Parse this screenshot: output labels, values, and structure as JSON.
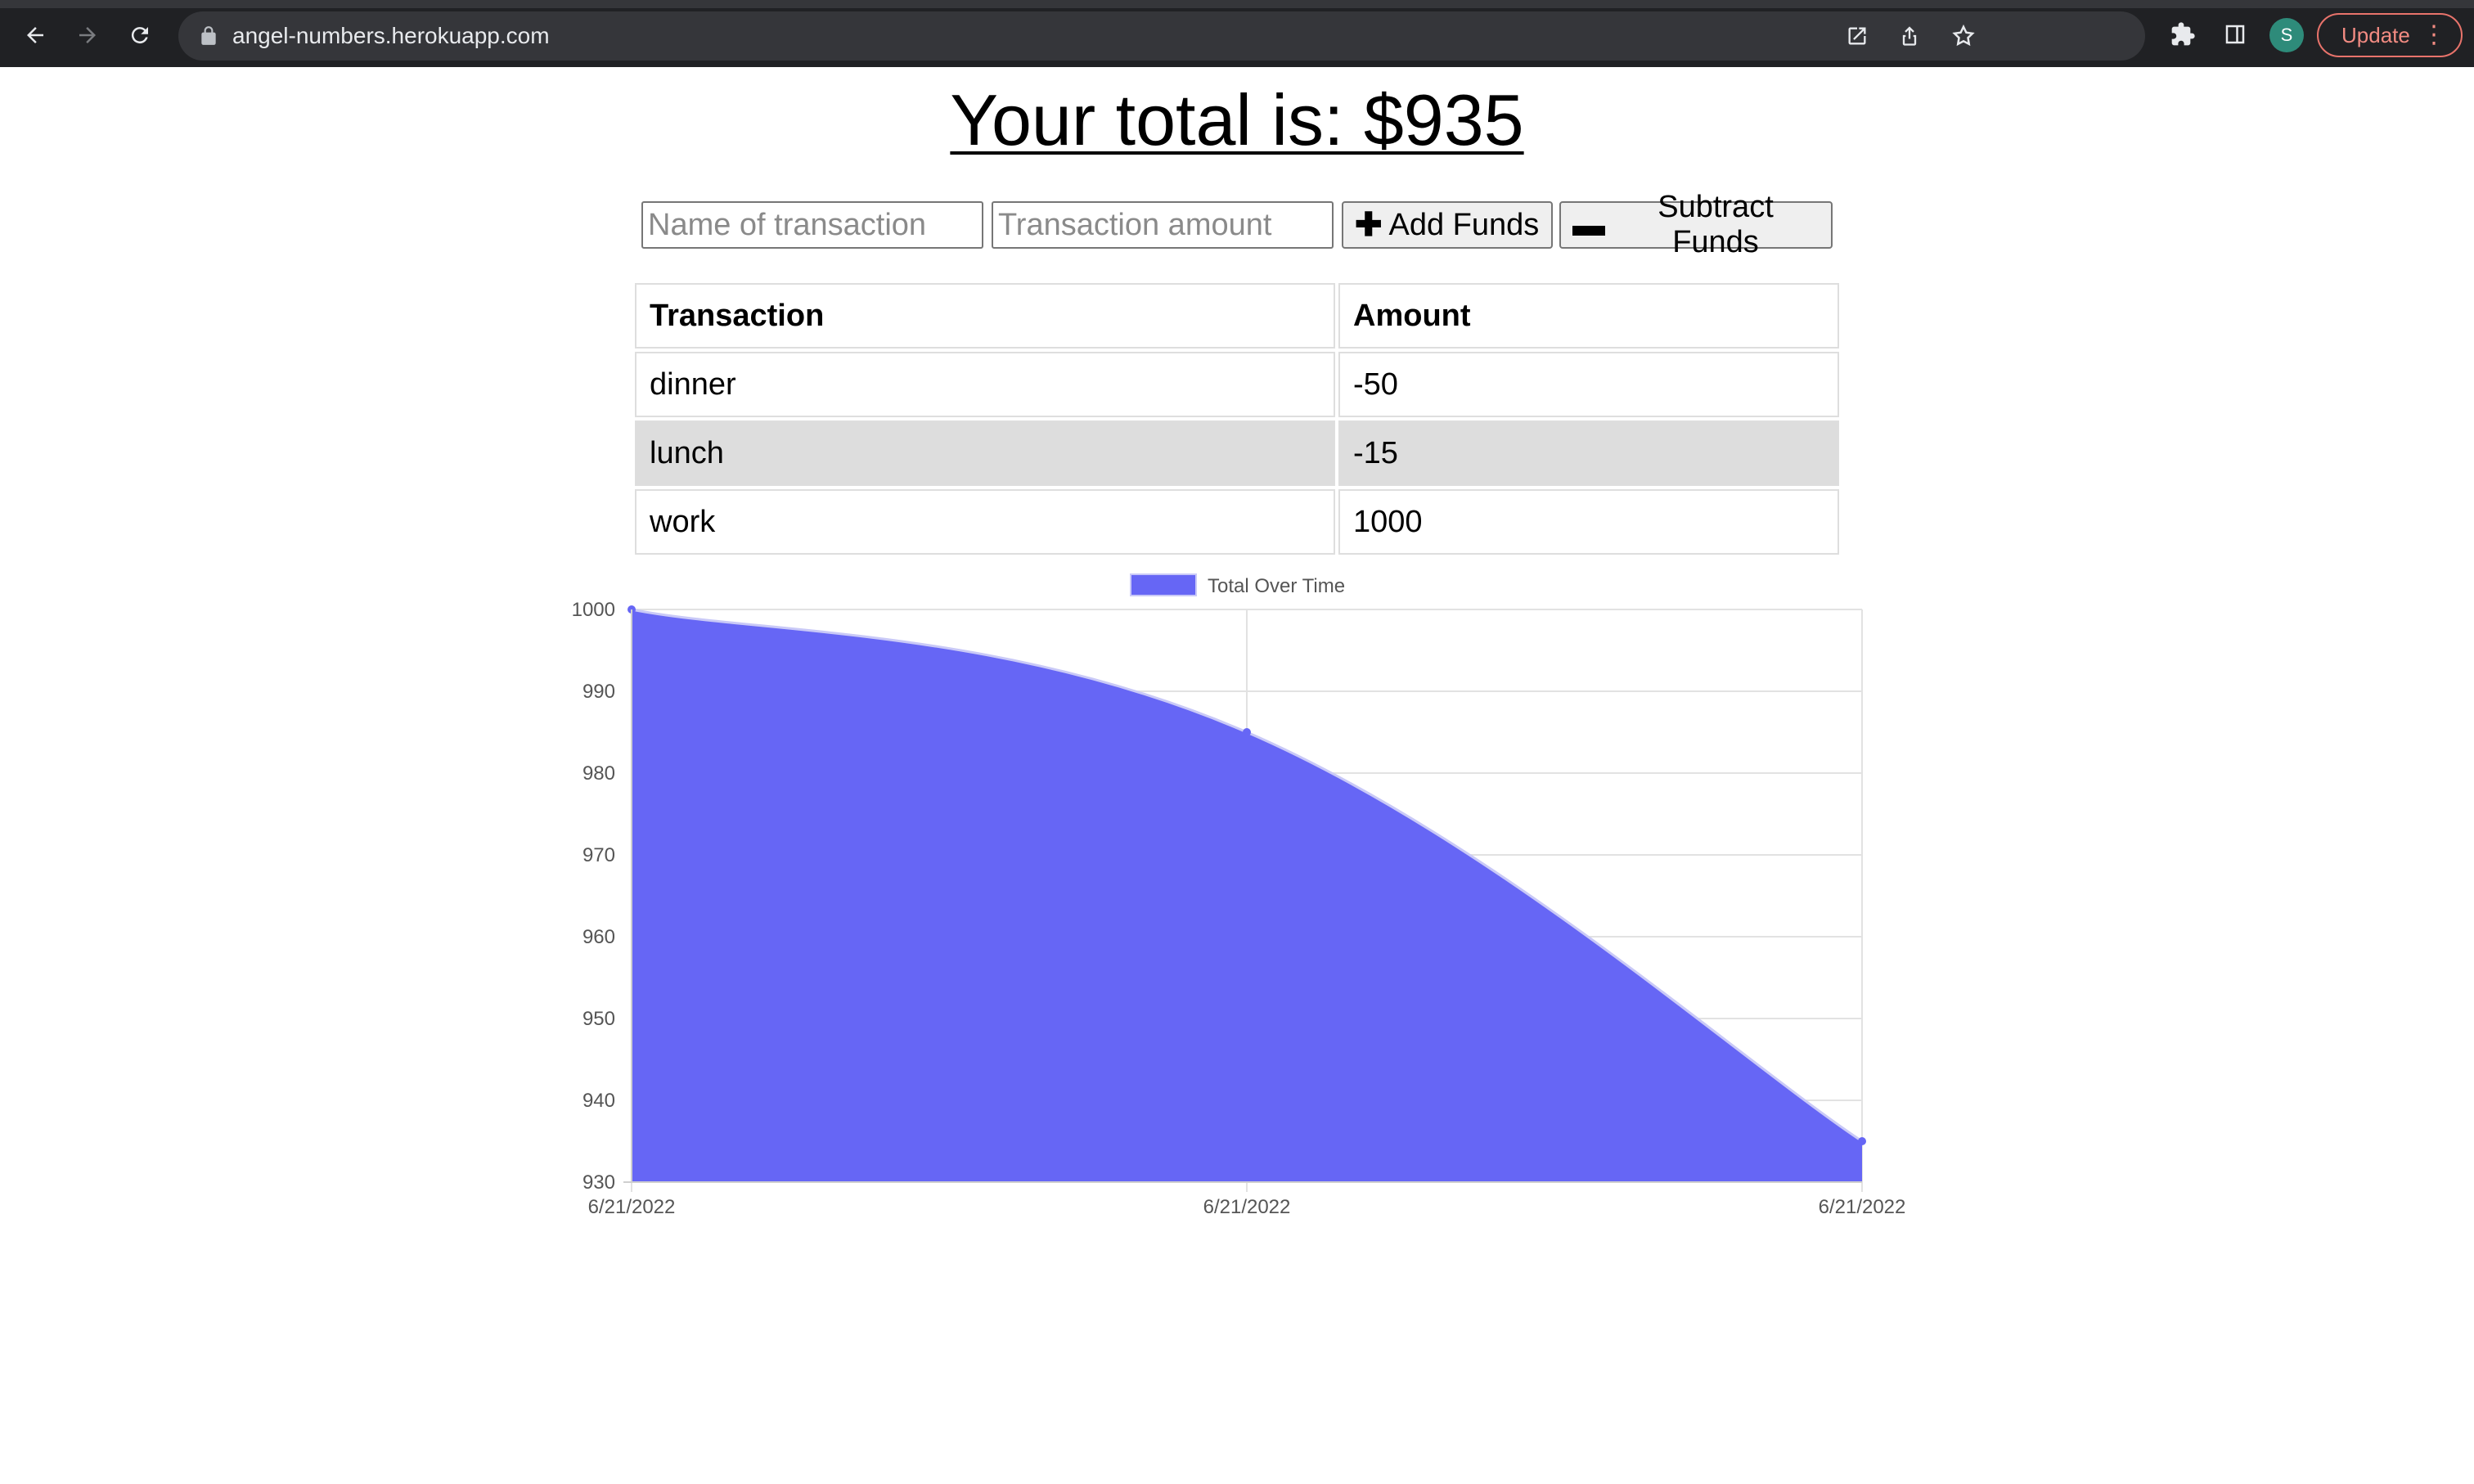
{
  "browser": {
    "url": "angel-numbers.herokuapp.com",
    "profile_initial": "S",
    "update_label": "Update"
  },
  "page": {
    "title": "Your total is: $935"
  },
  "form": {
    "name_placeholder": "Name of transaction",
    "amount_placeholder": "Transaction amount",
    "add_label": "Add Funds",
    "subtract_label": "Subtract Funds",
    "add_icon": "plus-icon",
    "subtract_icon": "minus-icon"
  },
  "table": {
    "headers": [
      "Transaction",
      "Amount"
    ],
    "rows": [
      {
        "name": "dinner",
        "amount": "-50"
      },
      {
        "name": "lunch",
        "amount": "-15"
      },
      {
        "name": "work",
        "amount": "1000"
      }
    ]
  },
  "chart_data": {
    "type": "area",
    "x": [
      "6/21/2022",
      "6/21/2022",
      "6/21/2022"
    ],
    "series": [
      {
        "name": "Total Over Time",
        "values": [
          1000,
          985,
          935
        ],
        "color": "#6666f5"
      }
    ],
    "ylim": [
      930,
      1000
    ],
    "yticks": [
      1000,
      990,
      980,
      970,
      960,
      950,
      940,
      930
    ],
    "grid": true,
    "legend": "top-center"
  }
}
